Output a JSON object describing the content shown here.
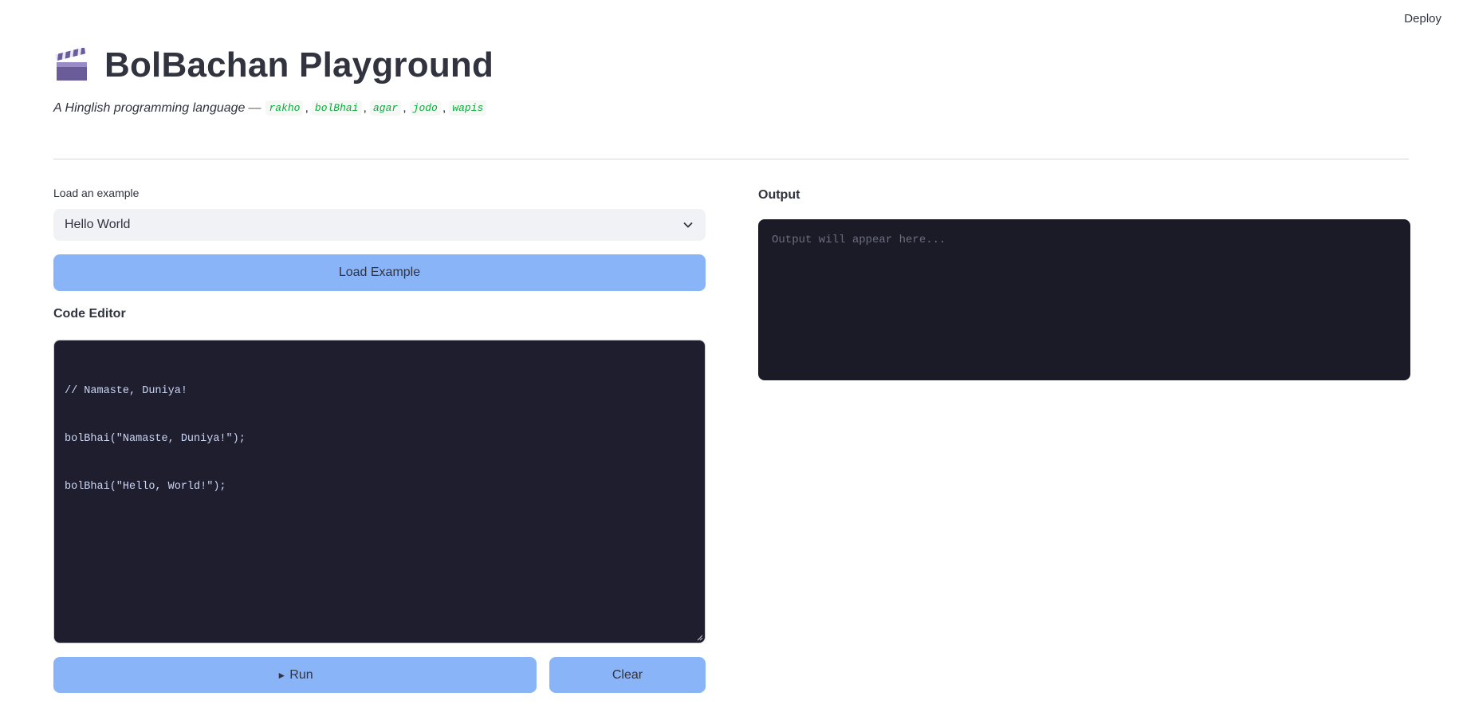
{
  "topbar": {
    "deploy_label": "Deploy"
  },
  "header": {
    "icon": "clapperboard-icon",
    "title": "BolBachan Playground",
    "subtitle_prefix": "A Hinglish programming language",
    "subtitle_dash": "—",
    "keywords": [
      "rakho",
      "bolBhai",
      "agar",
      "jodo",
      "wapis"
    ],
    "separator": ","
  },
  "examples": {
    "label": "Load an example",
    "selected": "Hello World",
    "load_button": "Load Example"
  },
  "editor": {
    "label": "Code Editor",
    "lines": [
      "// Namaste, Duniya!",
      "bolBhai(\"Namaste, Duniya!\");",
      "bolBhai(\"Hello, World!\");"
    ]
  },
  "actions": {
    "run_arrow": "►",
    "run_label": "Run",
    "clear_label": "Clear"
  },
  "output": {
    "label": "Output",
    "placeholder": "Output will appear here..."
  },
  "colors": {
    "button": "#8ab4f8",
    "editor_bg": "#1e1e2e",
    "output_bg": "#1a1b26",
    "keyword": "#09ab3b"
  }
}
